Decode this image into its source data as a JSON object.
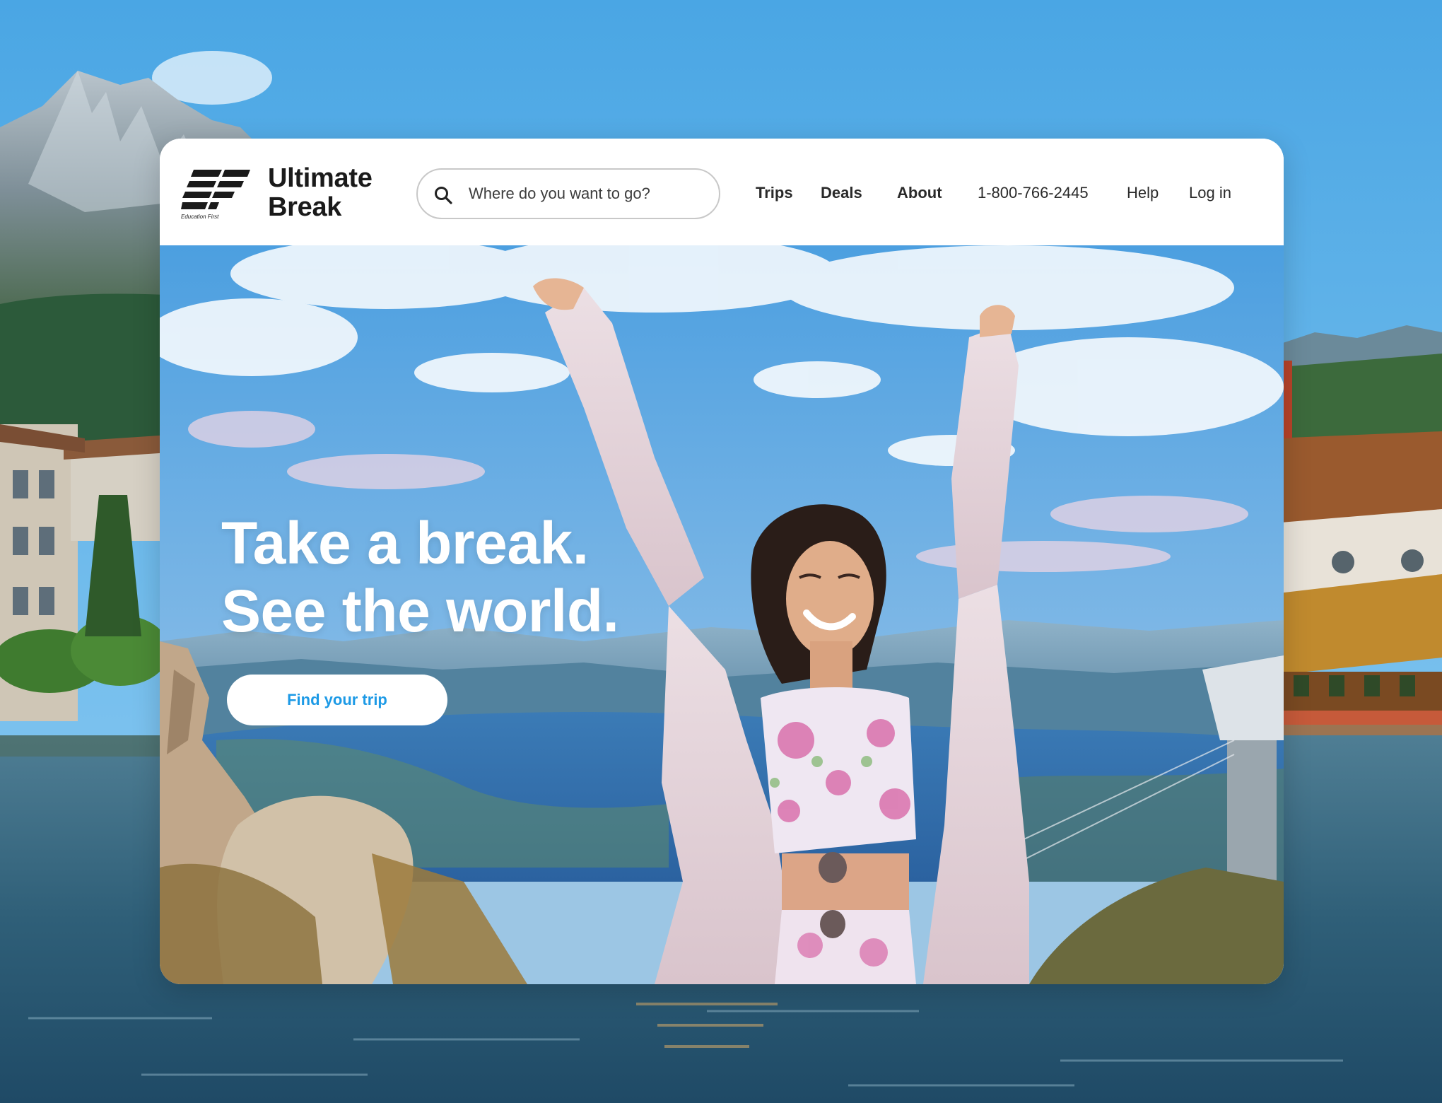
{
  "brand": {
    "logo_mark": "EF",
    "logo_tagline": "Education First",
    "name_line1": "Ultimate",
    "name_line2": "Break"
  },
  "search": {
    "icon": "search-icon",
    "placeholder": "Where do you want to go?"
  },
  "nav": {
    "trips": "Trips",
    "deals": "Deals",
    "about": "About",
    "phone": "1-800-766-2445",
    "help": "Help",
    "login": "Log in"
  },
  "hero": {
    "headline_line1": "Take a break.",
    "headline_line2": "See the world.",
    "cta_label": "Find your trip"
  },
  "colors": {
    "accent": "#1d9ae6",
    "text_dark": "#1a1a1a",
    "sky": "#6ab7ea"
  }
}
